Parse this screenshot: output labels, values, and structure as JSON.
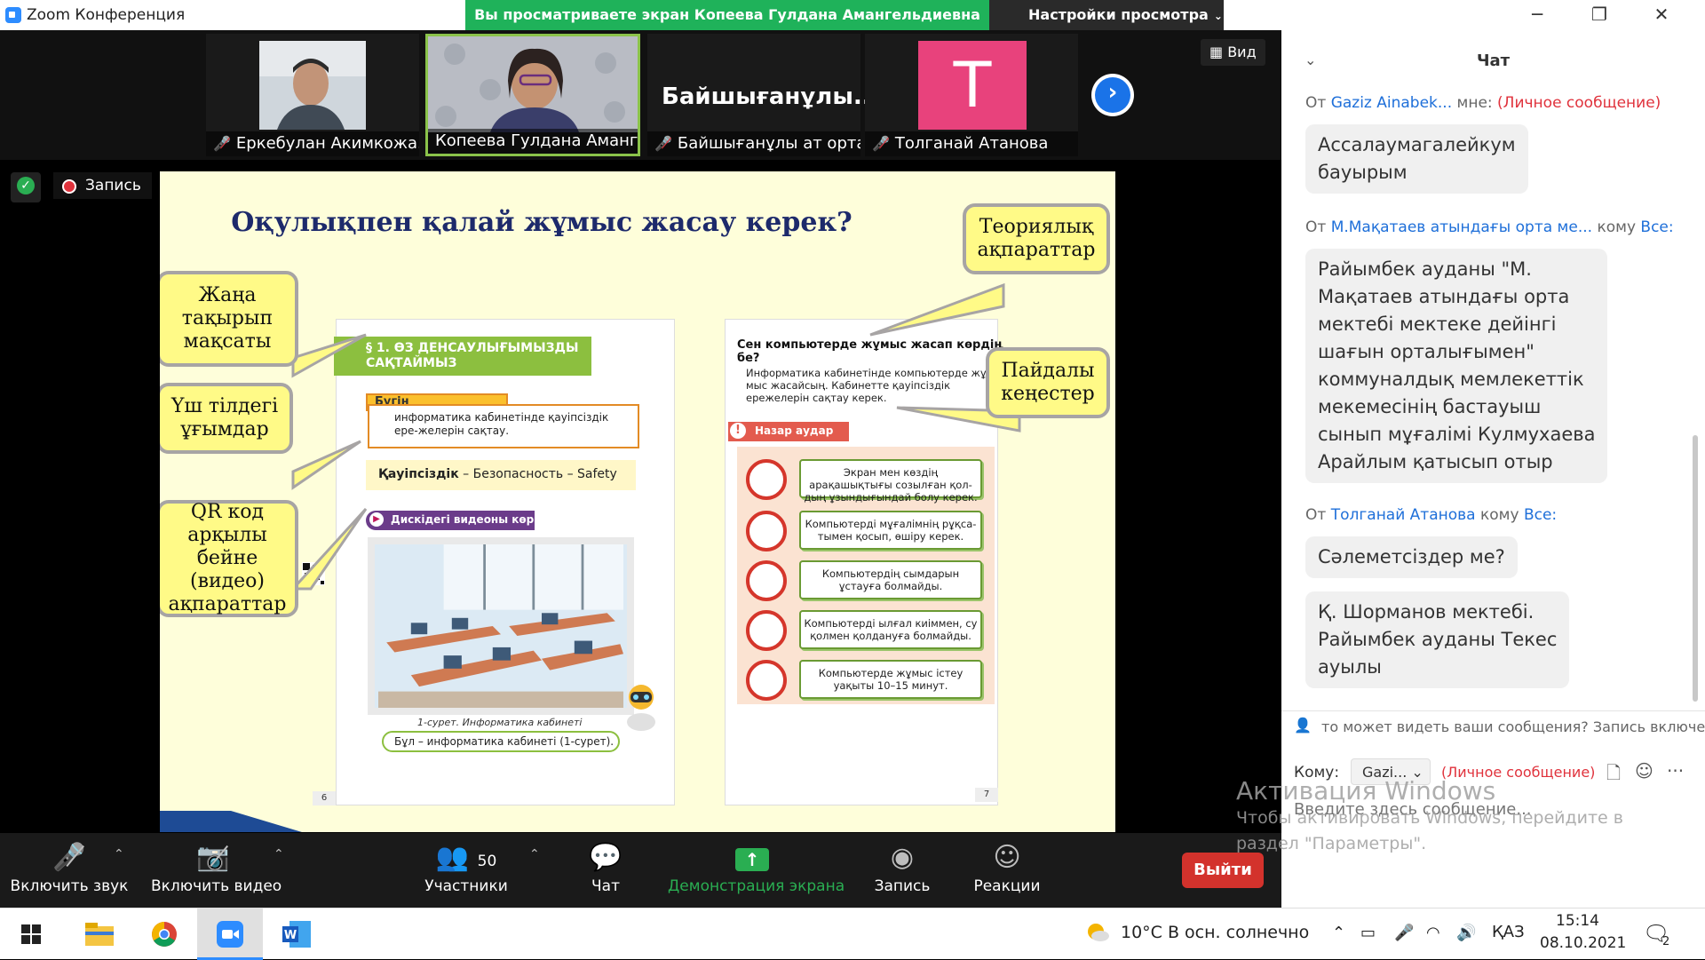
{
  "window": {
    "title": "Zoom Конференция",
    "share_banner": "Вы просматриваете экран Копеева Гулдана Амангельдиевна",
    "view_settings": "Настройки просмотра"
  },
  "participants": [
    {
      "name": "Еркебулан Акимкожа..."
    },
    {
      "name": "Копеева Гулдана Аманге..."
    },
    {
      "name": "Байшығанұлы ат орта...",
      "display": "Байшығанұлы..."
    },
    {
      "name": "Толганай Атанова",
      "avatar_letter": "T",
      "avatar_color": "#E8427C"
    }
  ],
  "view_button": "Вид",
  "recording_label": "Запись",
  "slide": {
    "heading": "Оқулықпен қалай жұмыс жасау керек?",
    "section_title": "§ 1. ӨЗ ДЕНСАУЛЫҒЫМЫЗДЫ САҚТАЙМЫЗ",
    "learn_tag": "Бүгін үйренетініміз:",
    "learn_text": "информатика кабинетінде қауіпсіздік ере-желерін сақтау.",
    "safety_term": "Қауіпсіздік",
    "safety_rest": " – Безопасность – Safety",
    "video_tag": "Дискідегі видеоны көр",
    "fig_caption": "1-сурет. Информатика кабинеті",
    "cap_box": "Бұл – информатика кабинеті (1-сурет).",
    "right_question": "Сен компьютерде жұмыс жасап көрдің бе?",
    "right_paragraph": "Информатика кабинетінде компьютерде жұ-мыс жасайсың. Кабинетте қауіпсіздік ережелерін сақтау керек.",
    "attention_tag": "Назар аудар",
    "rules": [
      "Экран мен көздің арақашықтығы созылған қол-дың ұзындығындай болу керек.",
      "Компьютерді мұғалімнің рұқса-тымен қосып, өшіру керек.",
      "Компьютердің сымдарын ұстауға болмайды.",
      "Компьютерді ылғал киіммен, су қолмен қолдануға болмайды.",
      "Компьютерде жұмыс істеу уақыты 10–15 минут."
    ],
    "page_left": "6",
    "page_right": "7",
    "bubbles": {
      "new_topic": "Жаңа тақырып мақсаты",
      "three_lang": "Үш тілдегі ұғымдар",
      "qr": "QR код арқылы бейне (видео) ақпараттар",
      "theory": "Теориялық ақпараттар",
      "tips": "Пайдалы кеңестер"
    }
  },
  "toolbar": {
    "mute": "Включить звук",
    "video": "Включить видео",
    "participants": "Участники",
    "participants_count": "50",
    "chat": "Чат",
    "share": "Демонстрация экрана",
    "record": "Запись",
    "reactions": "Реакции",
    "leave": "Выйти"
  },
  "chat": {
    "title": "Чат",
    "messages": [
      {
        "from": "От ",
        "sender": "Gaziz Ainabek...",
        "to_prefix": "  мне: ",
        "to": "(Личное сообщение)",
        "text": [
          "Ассалаумагалейкум",
          "бауырым"
        ]
      },
      {
        "from": "От ",
        "sender": "М.Мақатаев атындағы орта ме...",
        "to_prefix": " кому ",
        "to": "Все:",
        "text": [
          "Райымбек ауданы \"М.",
          "Мақатаев атындағы орта",
          "мектебі мектеке дейінгі",
          "шағын орталығымен\"",
          "коммуналдық мемлекеттік",
          "мекемесінің бастауыш",
          "сынып мұғалімі Кулмухаева",
          "Арайлым қатысып отыр"
        ]
      },
      {
        "from": "От ",
        "sender": "Толганай Атанова",
        "to_prefix": " кому ",
        "to": "Все:",
        "text": [
          "Сәлеметсіздер ме?"
        ]
      },
      {
        "text": [
          "Қ. Шорманов мектебі.",
          "Райымбек ауданы Текес",
          "ауылы"
        ]
      }
    ],
    "notice": "то может видеть ваши сообщения? Запись включе",
    "to_label": "Кому:",
    "to_select": "Gazi...",
    "to_private": "(Личное сообщение)",
    "input_placeholder": "Введите здесь сообщение..."
  },
  "activation": {
    "title": "Активация Windows",
    "line1": "Чтобы активировать Windows, перейдите в",
    "line2": "раздел \"Параметры\"."
  },
  "taskbar": {
    "weather": "10°C  В осн. солнечно",
    "lang": "ҚАЗ",
    "time": "15:14",
    "date": "08.10.2021",
    "notif_count": "2"
  }
}
